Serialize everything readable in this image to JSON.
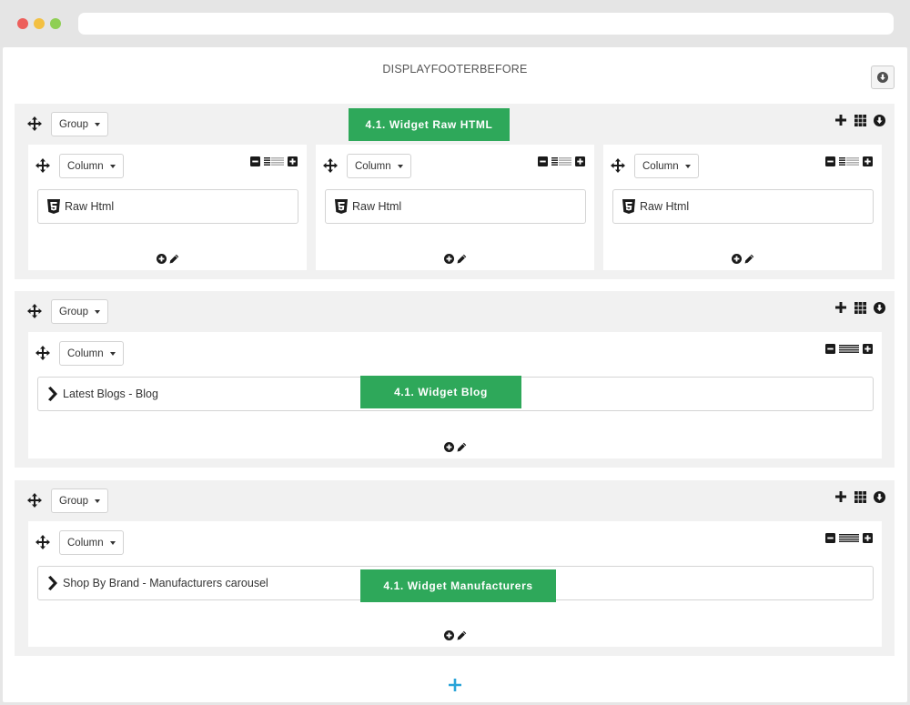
{
  "hook": {
    "title": "DISPLAYFOOTERBEFORE"
  },
  "labels": {
    "group": "Group",
    "column": "Column"
  },
  "groups": [
    {
      "columns": [
        {
          "widget": "Raw Html",
          "widget_icon": "html5-icon"
        },
        {
          "widget": "Raw Html",
          "widget_icon": "html5-icon"
        },
        {
          "widget": "Raw Html",
          "widget_icon": "html5-icon"
        }
      ]
    },
    {
      "columns": [
        {
          "widget": "Latest Blogs - Blog",
          "widget_icon": "chevron-right-icon"
        }
      ]
    },
    {
      "columns": [
        {
          "widget": "Shop By Brand - Manufacturers carousel",
          "widget_icon": "chevron-right-icon"
        }
      ]
    }
  ],
  "annotations": [
    {
      "text": "4.1. Widget Raw HTML"
    },
    {
      "text": "4.1. Widget Blog"
    },
    {
      "text": "4.1. Widget Manufacturers"
    }
  ],
  "colors": {
    "accent": "#2ea85a",
    "add": "#2aa4d8"
  }
}
